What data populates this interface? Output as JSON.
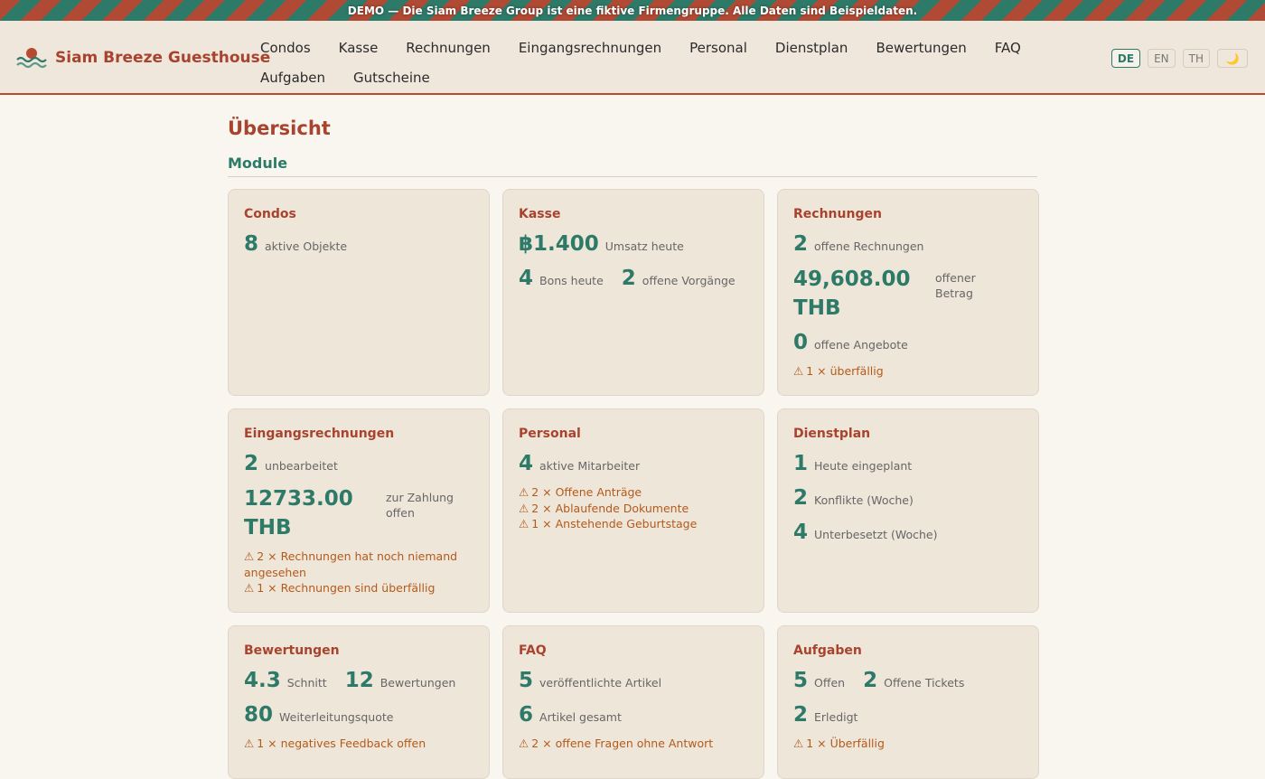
{
  "banner": "DEMO — Die Siam Breeze Group ist eine fiktive Firmengruppe. Alle Daten sind Beispieldaten.",
  "brand": {
    "name": "Siam Breeze Guesthouse",
    "logo_icon": "sun-over-waves-logo"
  },
  "nav": [
    "Condos",
    "Kasse",
    "Rechnungen",
    "Eingangsrechnungen",
    "Personal",
    "Dienstplan",
    "Bewertungen",
    "FAQ",
    "Aufgaben",
    "Gutscheine"
  ],
  "lang": {
    "de": "DE",
    "en": "EN",
    "th": "TH",
    "active": "DE",
    "theme_icon": "moon-icon"
  },
  "page": {
    "title": "Übersicht",
    "section": "Module"
  },
  "colors": {
    "accent": "#a8432e",
    "teal": "#2e7a68",
    "warning": "#b35a1b",
    "card_bg": "#efe6da"
  },
  "cards": {
    "condos": {
      "title": "Condos",
      "s1_num": "8",
      "s1_lbl": "aktive Objekte"
    },
    "kasse": {
      "title": "Kasse",
      "s1_num": "฿1.400",
      "s1_lbl": "Umsatz heute",
      "s2_num": "4",
      "s2_lbl": "Bons heute",
      "s3_num": "2",
      "s3_lbl": "offene Vorgänge"
    },
    "rechnungen": {
      "title": "Rechnungen",
      "s1_num": "2",
      "s1_lbl": "offene Rechnungen",
      "s2_num": "49,608.00 THB",
      "s2_lbl": "offener Betrag",
      "s3_num": "0",
      "s3_lbl": "offene Angebote",
      "warn1": "1 × überfällig"
    },
    "eingang": {
      "title": "Eingangsrechnungen",
      "s1_num": "2",
      "s1_lbl": "unbearbeitet",
      "s2_num": "12733.00 THB",
      "s2_lbl": "zur Zahlung offen",
      "warn1": "2 × Rechnungen hat noch niemand angesehen",
      "warn2": "1 × Rechnungen sind überfällig"
    },
    "personal": {
      "title": "Personal",
      "s1_num": "4",
      "s1_lbl": "aktive Mitarbeiter",
      "warn1": "2 × Offene Anträge",
      "warn2": "2 × Ablaufende Dokumente",
      "warn3": "1 × Anstehende Geburtstage"
    },
    "dienstplan": {
      "title": "Dienstplan",
      "s1_num": "1",
      "s1_lbl": "Heute eingeplant",
      "s2_num": "2",
      "s2_lbl": "Konflikte (Woche)",
      "s3_num": "4",
      "s3_lbl": "Unterbesetzt (Woche)"
    },
    "bewertungen": {
      "title": "Bewertungen",
      "s1_num": "4.3",
      "s1_lbl": "Schnitt",
      "s2_num": "12",
      "s2_lbl": "Bewertungen",
      "s3_num": "80",
      "s3_lbl": "Weiterleitungsquote",
      "warn1": "1 × negatives Feedback offen"
    },
    "faq": {
      "title": "FAQ",
      "s1_num": "5",
      "s1_lbl": "veröffentlichte Artikel",
      "s2_num": "6",
      "s2_lbl": "Artikel gesamt",
      "warn1": "2 × offene Fragen ohne Antwort"
    },
    "aufgaben": {
      "title": "Aufgaben",
      "s1_num": "5",
      "s1_lbl": "Offen",
      "s2_num": "2",
      "s2_lbl": "Offene Tickets",
      "s3_num": "2",
      "s3_lbl": "Erledigt",
      "warn1": "1 × Überfällig"
    }
  },
  "icons": {
    "warning": "⚠",
    "moon": "🌙"
  }
}
